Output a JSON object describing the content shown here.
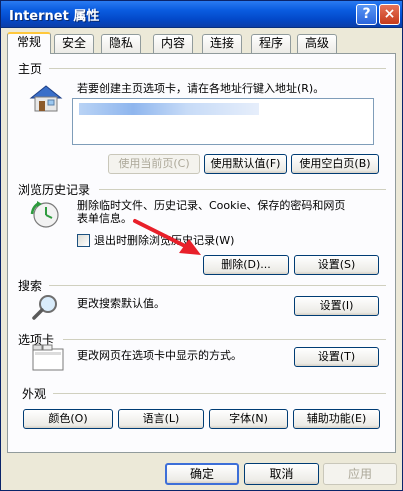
{
  "window": {
    "title": "Internet 属性",
    "help": "?",
    "close": "×"
  },
  "tabs": [
    "常规",
    "安全",
    "隐私",
    "内容",
    "连接",
    "程序",
    "高级"
  ],
  "homepage": {
    "section": "主页",
    "desc": "若要创建主页选项卡，请在各地址行键入地址(R)。",
    "use_current": "使用当前页(C)",
    "use_default": "使用默认值(F)",
    "use_blank": "使用空白页(B)"
  },
  "history": {
    "section": "浏览历史记录",
    "desc_line1": "删除临时文件、历史记录、Cookie、保存的密码和网页",
    "desc_line2": "表单信息。",
    "checkbox_label": "退出时删除浏览历史记录(W)",
    "delete_btn": "删除(D)...",
    "settings_btn": "设置(S)"
  },
  "search": {
    "section": "搜索",
    "desc": "更改搜索默认值。",
    "settings_btn": "设置(I)"
  },
  "tabs_section": {
    "section": "选项卡",
    "desc": "更改网页在选项卡中显示的方式。",
    "settings_btn": "设置(T)"
  },
  "appearance": {
    "section": "外观",
    "colors": "颜色(O)",
    "languages": "语言(L)",
    "fonts": "字体(N)",
    "accessibility": "辅助功能(E)"
  },
  "dialog": {
    "ok": "确定",
    "cancel": "取消",
    "apply": "应用"
  },
  "colors": {
    "titlebar": "#0a5ce0",
    "panel": "#fcfcfe",
    "arrow": "#e8202a"
  }
}
